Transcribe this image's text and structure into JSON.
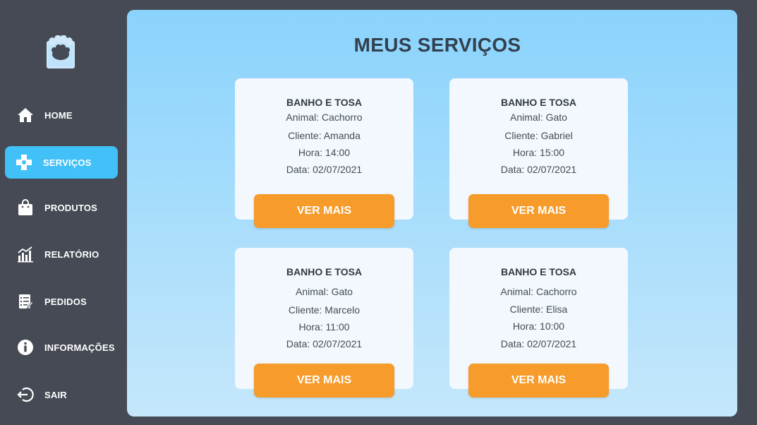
{
  "app": {
    "brand_icon": "paw-icon"
  },
  "sidebar": {
    "items": [
      {
        "label": "HOME",
        "icon": "home-icon",
        "active": false
      },
      {
        "label": "SERVIÇOS",
        "icon": "plus-icon",
        "active": true
      },
      {
        "label": "PRODUTOS",
        "icon": "shopping-bag-icon",
        "active": false
      },
      {
        "label": "RELATÓRIO",
        "icon": "chart-icon",
        "active": false
      },
      {
        "label": "PEDIDOS",
        "icon": "clipboard-icon",
        "active": false
      },
      {
        "label": "INFORMAÇÕES",
        "icon": "info-icon",
        "active": false
      },
      {
        "label": "SAIR",
        "icon": "logout-icon",
        "active": false
      }
    ],
    "active_color": "#42c0f8"
  },
  "main": {
    "title": "MEUS SERVIÇOS",
    "cards": [
      {
        "title": "BANHO E TOSA",
        "animal": "Animal: Cachorro",
        "cliente": "Cliente: Amanda",
        "hora": "Hora: 14:00",
        "data": "Data: 02/07/2021",
        "button": "VER MAIS"
      },
      {
        "title": "BANHO E TOSA",
        "animal": "Animal: Gato",
        "cliente": "Cliente: Gabriel",
        "hora": "Hora: 15:00",
        "data": "Data: 02/07/2021",
        "button": "VER MAIS"
      },
      {
        "title": "BANHO E TOSA",
        "animal": "Animal: Gato",
        "cliente": "Cliente: Marcelo",
        "hora": "Hora: 11:00",
        "data": "Data: 02/07/2021",
        "button": "VER MAIS"
      },
      {
        "title": "BANHO E TOSA",
        "animal": "Animal: Cachorro",
        "cliente": "Cliente: Elisa",
        "hora": "Hora: 10:00",
        "data": "Data: 02/07/2021",
        "button": "VER MAIS"
      }
    ]
  },
  "colors": {
    "sidebar_bg": "#454a54",
    "button": "#f79b2a",
    "title": "#334050"
  }
}
